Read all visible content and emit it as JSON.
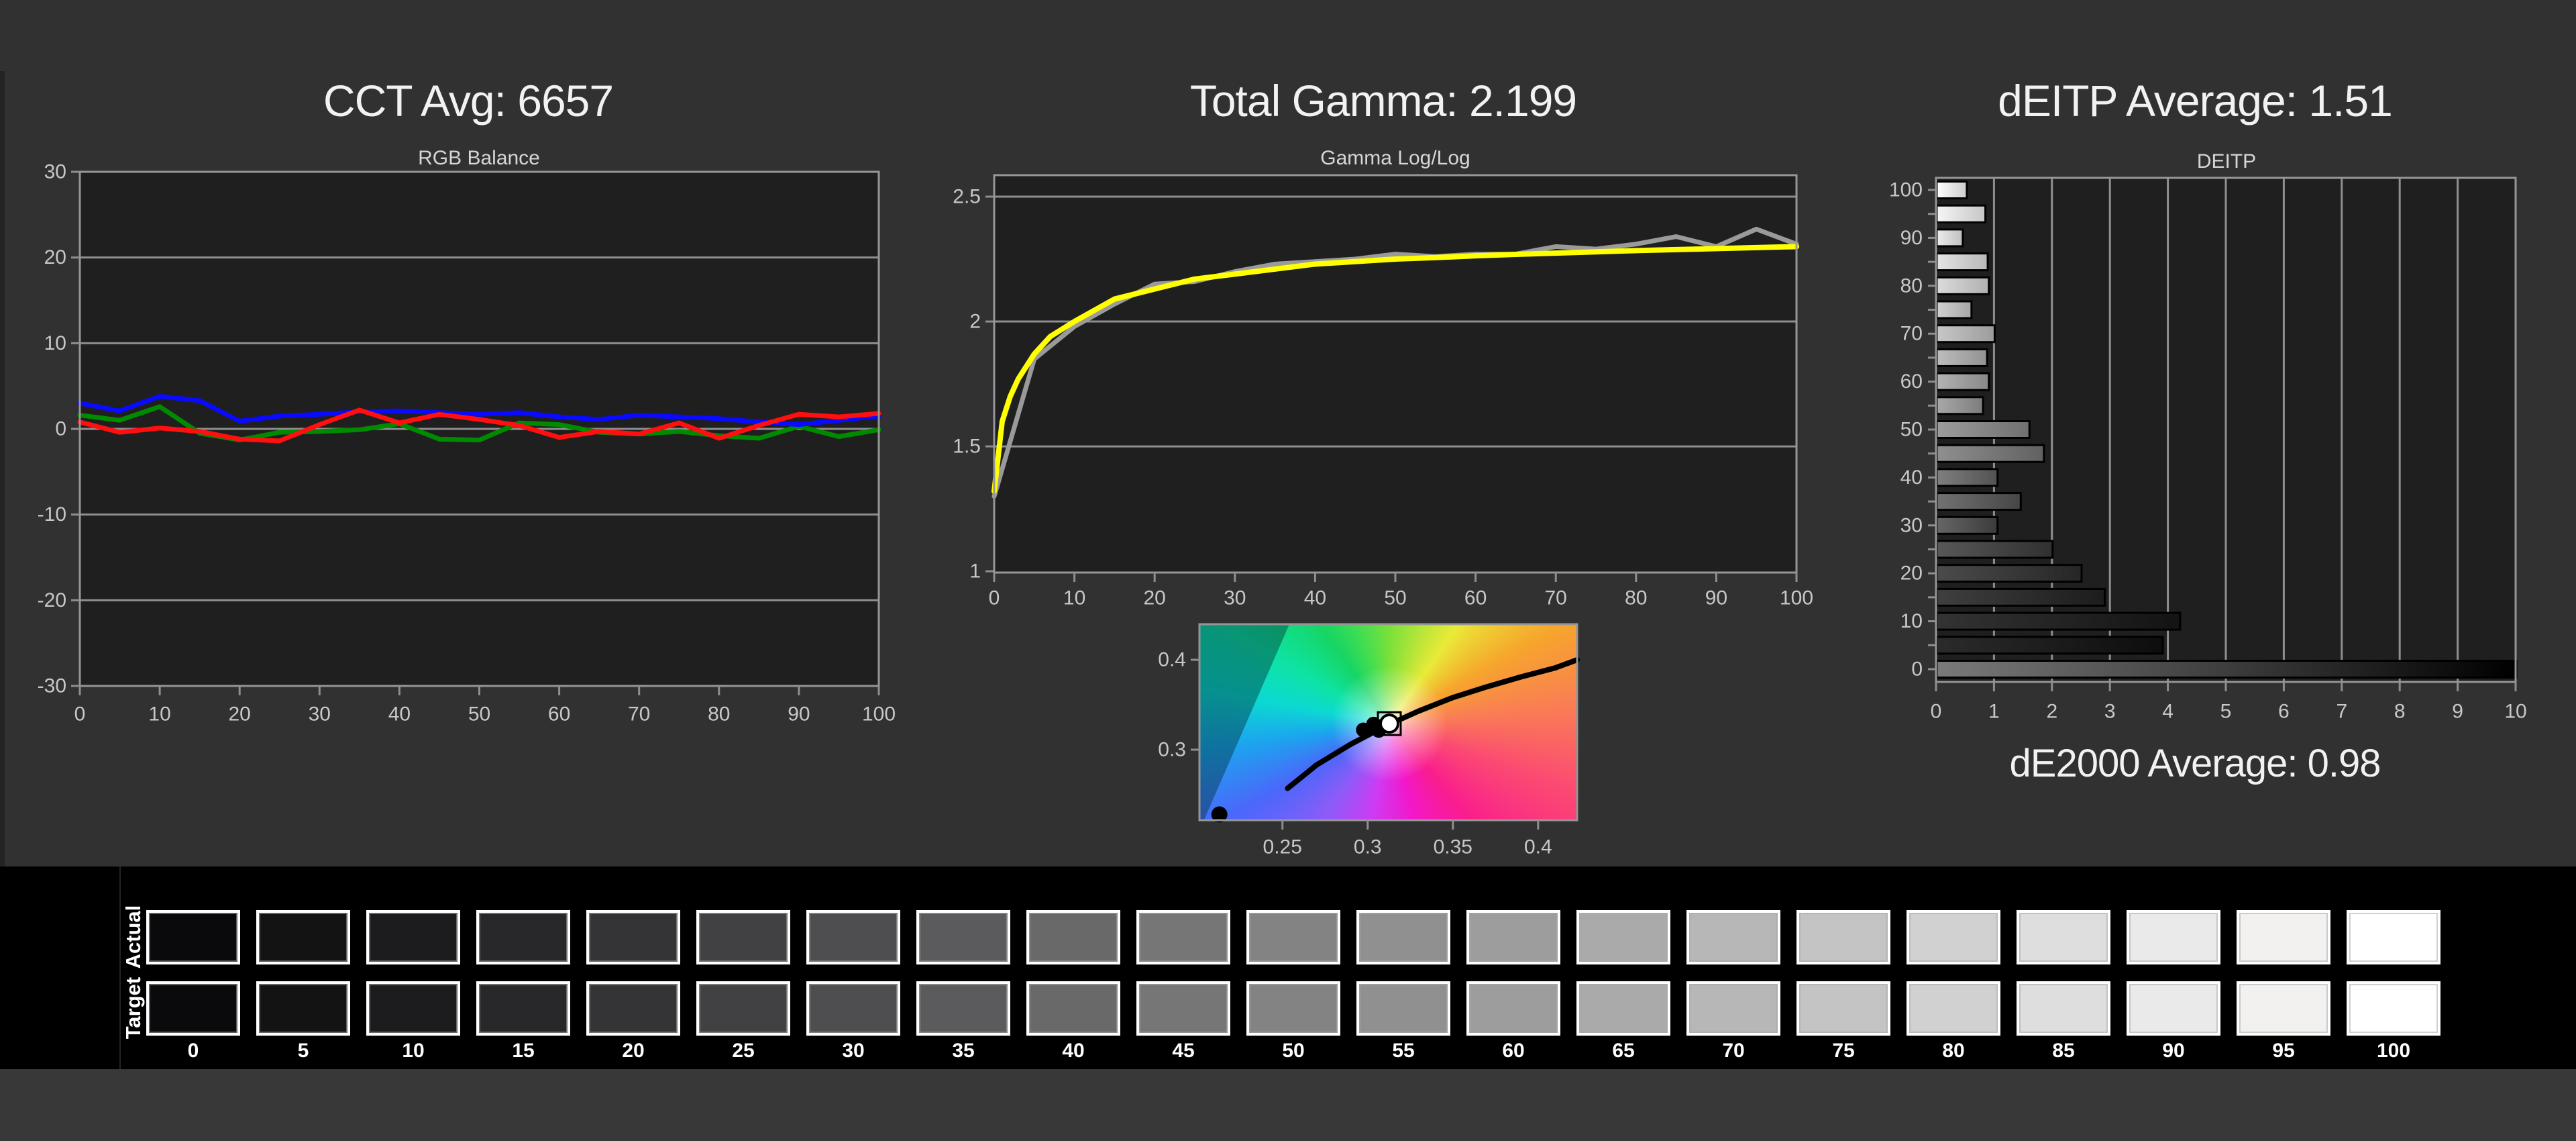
{
  "window": {
    "bg": "#313131",
    "plot_bg": "#1f1f1f",
    "grid_color": "#8f8f8f",
    "border_color": "#969696",
    "axis_text_color": "#c8c8c8",
    "title_color": "#f2f2f2"
  },
  "titles": {
    "cct": "CCT Avg: 6657",
    "gamma": "Total Gamma: 2.199",
    "deitp": "dEITP Average: 1.51",
    "de2000": "dE2000 Average: 0.98"
  },
  "chart_data": [
    {
      "id": "rgb_balance",
      "type": "line",
      "title": "RGB Balance",
      "xlabel": "",
      "ylabel": "",
      "xlim": [
        0,
        100
      ],
      "ylim": [
        -30,
        30
      ],
      "grid": true,
      "x": [
        0,
        5,
        10,
        15,
        20,
        25,
        30,
        35,
        40,
        45,
        50,
        55,
        60,
        65,
        70,
        75,
        80,
        85,
        90,
        95,
        100
      ],
      "xticks": [
        {
          "v": 0,
          "label": "0"
        },
        {
          "v": 10,
          "label": "10"
        },
        {
          "v": 20,
          "label": "20"
        },
        {
          "v": 30,
          "label": "30"
        },
        {
          "v": 40,
          "label": "40"
        },
        {
          "v": 50,
          "label": "50"
        },
        {
          "v": 60,
          "label": "60"
        },
        {
          "v": 70,
          "label": "70"
        },
        {
          "v": 80,
          "label": "80"
        },
        {
          "v": 90,
          "label": "90"
        },
        {
          "v": 100,
          "label": "100"
        }
      ],
      "yticks": [
        {
          "v": 30,
          "label": "30"
        },
        {
          "v": 20,
          "label": "20"
        },
        {
          "v": 10,
          "label": "10"
        },
        {
          "v": 0,
          "label": "0"
        },
        {
          "v": -10,
          "label": "-10"
        },
        {
          "v": -20,
          "label": "-20"
        },
        {
          "v": -30,
          "label": "-30"
        }
      ],
      "series": [
        {
          "name": "green",
          "color": "#008a00",
          "values": [
            1.6,
            1.0,
            2.6,
            -0.5,
            -1.3,
            -0.4,
            -0.3,
            -0.1,
            0.6,
            -1.2,
            -1.3,
            0.7,
            0.5,
            -0.4,
            -0.6,
            -0.3,
            -0.8,
            -1.1,
            0.3,
            -0.9,
            -0.1
          ]
        },
        {
          "name": "blue",
          "color": "#0a0aff",
          "values": [
            3.0,
            2.1,
            3.8,
            3.3,
            0.9,
            1.5,
            1.7,
            2.0,
            2.1,
            1.9,
            1.7,
            1.9,
            1.4,
            1.1,
            1.6,
            1.4,
            1.2,
            0.8,
            0.5,
            1.0,
            1.5
          ]
        },
        {
          "name": "red",
          "color": "#ff0f0f",
          "values": [
            0.8,
            -0.4,
            0.1,
            -0.3,
            -1.2,
            -1.4,
            0.5,
            2.2,
            0.7,
            1.7,
            1.1,
            0.4,
            -1.0,
            -0.3,
            -0.6,
            0.7,
            -1.1,
            0.4,
            1.7,
            1.4,
            1.8
          ]
        }
      ]
    },
    {
      "id": "gamma_loglog",
      "type": "line",
      "title": "Gamma Log/Log",
      "xlabel": "",
      "ylabel": "",
      "xlim": [
        0,
        100
      ],
      "ylim": [
        0.995,
        2.586
      ],
      "grid": true,
      "xticks": [
        {
          "v": 0,
          "label": "0"
        },
        {
          "v": 10,
          "label": "10"
        },
        {
          "v": 20,
          "label": "20"
        },
        {
          "v": 30,
          "label": "30"
        },
        {
          "v": 40,
          "label": "40"
        },
        {
          "v": 50,
          "label": "50"
        },
        {
          "v": 60,
          "label": "60"
        },
        {
          "v": 70,
          "label": "70"
        },
        {
          "v": 80,
          "label": "80"
        },
        {
          "v": 90,
          "label": "90"
        },
        {
          "v": 100,
          "label": "100"
        }
      ],
      "yticks": [
        {
          "v": 2.5,
          "label": "2.5"
        },
        {
          "v": 2,
          "label": "2"
        },
        {
          "v": 1.5,
          "label": "1.5"
        },
        {
          "v": 1,
          "label": "1"
        }
      ],
      "series": [
        {
          "name": "measured",
          "color": "#9a9a9a",
          "x": [
            0,
            5,
            10,
            15,
            20,
            25,
            30,
            35,
            40,
            45,
            50,
            55,
            60,
            65,
            70,
            75,
            80,
            85,
            90,
            95,
            100
          ],
          "values": [
            1.3,
            1.85,
            1.98,
            2.07,
            2.15,
            2.16,
            2.2,
            2.23,
            2.24,
            2.25,
            2.27,
            2.26,
            2.27,
            2.27,
            2.3,
            2.29,
            2.31,
            2.34,
            2.3,
            2.37,
            2.31
          ]
        },
        {
          "name": "target",
          "color": "#ffff00",
          "x": [
            0,
            1,
            2,
            3,
            5,
            7,
            10,
            15,
            20,
            25,
            30,
            35,
            40,
            45,
            50,
            55,
            60,
            65,
            70,
            75,
            80,
            85,
            90,
            95,
            100
          ],
          "values": [
            1.32,
            1.6,
            1.7,
            1.77,
            1.87,
            1.94,
            2.0,
            2.09,
            2.13,
            2.17,
            2.19,
            2.21,
            2.23,
            2.24,
            2.25,
            2.256,
            2.263,
            2.269,
            2.274,
            2.279,
            2.284,
            2.288,
            2.292,
            2.296,
            2.3
          ]
        }
      ]
    },
    {
      "id": "cie_chromaticity",
      "type": "scatter",
      "title": "",
      "xlim": [
        0.2013,
        0.4229
      ],
      "ylim": [
        0.2216,
        0.4396
      ],
      "xticks": [
        {
          "v": 0.25,
          "label": "0.25"
        },
        {
          "v": 0.3,
          "label": "0.3"
        },
        {
          "v": 0.35,
          "label": "0.35"
        },
        {
          "v": 0.4,
          "label": "0.4"
        }
      ],
      "yticks": [
        {
          "v": 0.4,
          "label": "0.4"
        },
        {
          "v": 0.3,
          "label": "0.3"
        }
      ],
      "locus": [
        [
          0.253,
          0.257
        ],
        [
          0.27,
          0.283
        ],
        [
          0.29,
          0.306
        ],
        [
          0.31,
          0.326
        ],
        [
          0.33,
          0.343
        ],
        [
          0.35,
          0.358
        ],
        [
          0.37,
          0.37
        ],
        [
          0.39,
          0.381
        ],
        [
          0.41,
          0.391
        ],
        [
          0.423,
          0.4
        ]
      ],
      "points": [
        [
          0.2975,
          0.322
        ],
        [
          0.3035,
          0.3285
        ],
        [
          0.3065,
          0.3215
        ],
        [
          0.3085,
          0.326
        ]
      ],
      "white_point": [
        0.3127,
        0.329
      ],
      "outlier": [
        0.213,
        0.228
      ]
    },
    {
      "id": "deitp",
      "type": "bar",
      "title": "DEITP",
      "xlabel": "",
      "ylabel": "",
      "xlim": [
        0,
        10
      ],
      "grid": true,
      "categories": [
        100,
        95,
        90,
        85,
        80,
        75,
        70,
        65,
        60,
        55,
        50,
        45,
        40,
        35,
        30,
        25,
        20,
        15,
        10,
        5,
        0
      ],
      "values": [
        0.52,
        0.84,
        0.45,
        0.88,
        0.9,
        0.6,
        1.0,
        0.87,
        0.9,
        0.8,
        1.6,
        1.85,
        1.05,
        1.45,
        1.05,
        2.0,
        2.5,
        2.9,
        4.2,
        3.9,
        10
      ],
      "bar_colors": [
        [
          "#ffffff",
          "#cccccc"
        ],
        [
          "#f6f6f6",
          "#c6c6c6"
        ],
        [
          "#ededed",
          "#bfbfbf"
        ],
        [
          "#e4e4e4",
          "#b8b8b8"
        ],
        [
          "#dbdbdb",
          "#b0b0b0"
        ],
        [
          "#d1d1d1",
          "#a6a6a6"
        ],
        [
          "#c7c7c7",
          "#9c9c9c"
        ],
        [
          "#bdbdbd",
          "#929292"
        ],
        [
          "#b3b3b3",
          "#888888"
        ],
        [
          "#a8a8a8",
          "#7d7d7d"
        ],
        [
          "#9c9c9c",
          "#6f6f6f"
        ],
        [
          "#8f8f8f",
          "#616161"
        ],
        [
          "#7f7f7f",
          "#525252"
        ],
        [
          "#727272",
          "#464646"
        ],
        [
          "#666666",
          "#3b3b3b"
        ],
        [
          "#585858",
          "#303030"
        ],
        [
          "#4b4b4b",
          "#262626"
        ],
        [
          "#3f3f3f",
          "#1c1c1c"
        ],
        [
          "#333333",
          "#131313"
        ],
        [
          "#2b2b2b",
          "#0d0d0d"
        ],
        [
          "#7a7a7a",
          "#000000"
        ]
      ],
      "xticks": [
        {
          "v": 0,
          "label": "0"
        },
        {
          "v": 1,
          "label": "1"
        },
        {
          "v": 2,
          "label": "2"
        },
        {
          "v": 3,
          "label": "3"
        },
        {
          "v": 4,
          "label": "4"
        },
        {
          "v": 5,
          "label": "5"
        },
        {
          "v": 6,
          "label": "6"
        },
        {
          "v": 7,
          "label": "7"
        },
        {
          "v": 8,
          "label": "8"
        },
        {
          "v": 9,
          "label": "9"
        },
        {
          "v": 10,
          "label": "10"
        }
      ]
    }
  ],
  "grayscale_strip": {
    "row_labels": [
      "Actual",
      "Target"
    ],
    "levels": [
      0,
      5,
      10,
      15,
      20,
      25,
      30,
      35,
      40,
      45,
      50,
      55,
      60,
      65,
      70,
      75,
      80,
      85,
      90,
      95,
      100
    ],
    "labels": [
      "0",
      "5",
      "10",
      "15",
      "20",
      "25",
      "30",
      "35",
      "40",
      "45",
      "50",
      "55",
      "60",
      "65",
      "70",
      "75",
      "80",
      "85",
      "90",
      "95",
      "100"
    ],
    "swatch_hex": [
      "#0a0a0c",
      "#131314",
      "#1c1c1e",
      "#28282a",
      "#343436",
      "#414143",
      "#4e4e50",
      "#5b5b5d",
      "#69696a",
      "#767677",
      "#838384",
      "#909091",
      "#9d9d9e",
      "#aaaaab",
      "#b7b7b8",
      "#c4c4c5",
      "#d1d1d2",
      "#dedede",
      "#eaeaea",
      "#f2f1ef",
      "#ffffff"
    ]
  }
}
